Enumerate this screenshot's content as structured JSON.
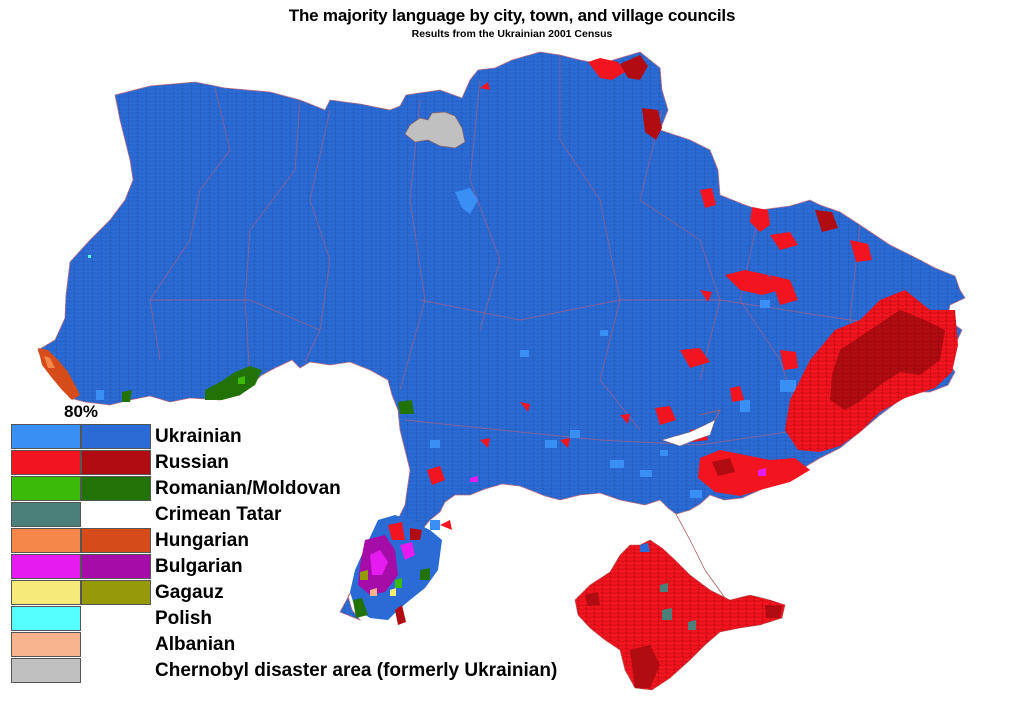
{
  "title": "The majority language by city, town, and village councils",
  "subtitle": "Results from the Ukrainian 2001 Census",
  "legend": {
    "threshold_label": "80%",
    "items": [
      {
        "label": "Ukrainian",
        "color_below_80": "#3a8ff5",
        "color_above_80": "#2a6bd6"
      },
      {
        "label": "Russian",
        "color_below_80": "#f2141e",
        "color_above_80": "#b00c12"
      },
      {
        "label": "Romanian/Moldovan",
        "color_below_80": "#3bba08",
        "color_above_80": "#217306"
      },
      {
        "label": "Crimean Tatar",
        "color_below_80": "#4a7f7a",
        "color_above_80": null
      },
      {
        "label": "Hungarian",
        "color_below_80": "#f5874a",
        "color_above_80": "#d64b1a"
      },
      {
        "label": "Bulgarian",
        "color_below_80": "#e61bf0",
        "color_above_80": "#a50ca8"
      },
      {
        "label": "Gagauz",
        "color_below_80": "#f5ea7a",
        "color_above_80": "#969a0a"
      },
      {
        "label": "Polish",
        "color_below_80": "#55ffff",
        "color_above_80": null
      },
      {
        "label": "Albanian",
        "color_below_80": "#f7b38e",
        "color_above_80": null
      },
      {
        "label": "Chernobyl disaster area (formerly Ukrainian)",
        "color_below_80": "#c0c0c0",
        "color_above_80": null
      }
    ]
  },
  "map": {
    "regions": [
      {
        "name": "mainland-ukraine",
        "language": "Ukrainian",
        "share": "above 80%"
      },
      {
        "name": "crimea",
        "language": "Russian",
        "share": "mixed"
      },
      {
        "name": "donbas",
        "language": "Russian",
        "share": "mixed"
      },
      {
        "name": "budjak",
        "language": "Bulgarian / Romanian/Moldovan / Gagauz / Russian",
        "share": "mixed"
      },
      {
        "name": "zakarpattia-border",
        "language": "Hungarian",
        "share": "mixed"
      },
      {
        "name": "chernivtsi-border",
        "language": "Romanian/Moldovan",
        "share": "mixed"
      },
      {
        "name": "chernobyl-zone",
        "language": "Chernobyl disaster area (formerly Ukrainian)",
        "share": null
      }
    ]
  }
}
